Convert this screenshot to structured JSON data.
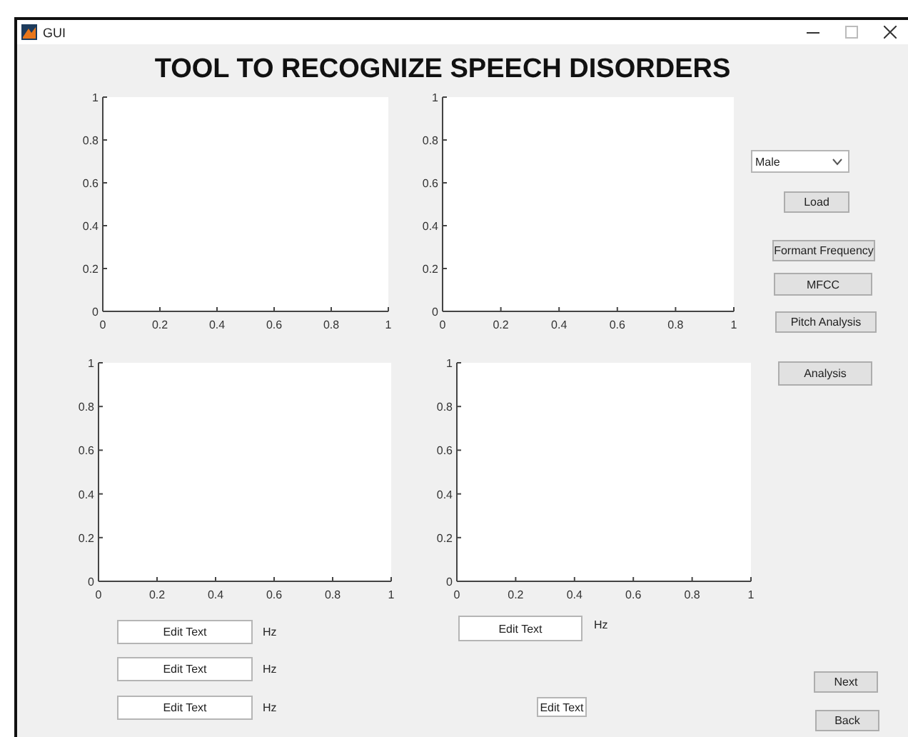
{
  "window": {
    "title": "GUI"
  },
  "heading": "TOOL TO RECOGNIZE SPEECH DISORDERS",
  "axes": [
    {
      "chart_data": {
        "type": "line",
        "xlim": [
          0,
          1
        ],
        "ylim": [
          0,
          1
        ],
        "xticks": [
          0,
          0.2,
          0.4,
          0.6,
          0.8,
          1
        ],
        "yticks": [
          0,
          0.2,
          0.4,
          0.6,
          0.8,
          1
        ]
      }
    },
    {
      "chart_data": {
        "type": "line",
        "xlim": [
          0,
          1
        ],
        "ylim": [
          0,
          1
        ],
        "xticks": [
          0,
          0.2,
          0.4,
          0.6,
          0.8,
          1
        ],
        "yticks": [
          0,
          0.2,
          0.4,
          0.6,
          0.8,
          1
        ]
      }
    },
    {
      "chart_data": {
        "type": "line",
        "xlim": [
          0,
          1
        ],
        "ylim": [
          0,
          1
        ],
        "xticks": [
          0,
          0.2,
          0.4,
          0.6,
          0.8,
          1
        ],
        "yticks": [
          0,
          0.2,
          0.4,
          0.6,
          0.8,
          1
        ]
      }
    },
    {
      "chart_data": {
        "type": "line",
        "xlim": [
          0,
          1
        ],
        "ylim": [
          0,
          1
        ],
        "xticks": [
          0,
          0.2,
          0.4,
          0.6,
          0.8,
          1
        ],
        "yticks": [
          0,
          0.2,
          0.4,
          0.6,
          0.8,
          1
        ]
      }
    }
  ],
  "gender_dropdown": {
    "value": "Male"
  },
  "buttons": [
    "Load",
    "Formant Frequency",
    "MFCC",
    "Pitch Analysis",
    "Analysis"
  ],
  "frequency_fields": [
    {
      "value": "Edit Text",
      "unit": "Hz"
    },
    {
      "value": "Edit Text",
      "unit": "Hz"
    },
    {
      "value": "Edit Text",
      "unit": "Hz"
    }
  ],
  "right_field": {
    "value": "Edit Text",
    "unit": "Hz"
  },
  "small_field": {
    "value": "Edit Text"
  },
  "nav_buttons": [
    "Next",
    "Back"
  ]
}
